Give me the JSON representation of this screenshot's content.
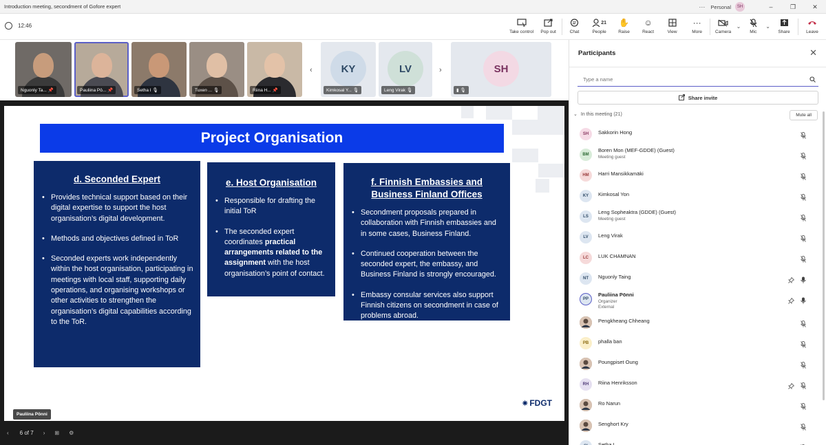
{
  "window": {
    "title": "Introduction meeting, secondment of Gofore expert",
    "profile": "Personal",
    "profile_initials": "SH"
  },
  "meeting": {
    "elapsed": "12:46",
    "people_count": "21"
  },
  "toolbar": {
    "take_control": "Take control",
    "pop_out": "Pop out",
    "chat": "Chat",
    "people": "People",
    "raise": "Raise",
    "react": "React",
    "view": "View",
    "more": "More",
    "camera": "Camera",
    "mic": "Mic",
    "share": "Share",
    "leave": "Leave"
  },
  "video_strip": [
    {
      "label": "Nguonly Ta..."
    },
    {
      "label": "Pauliina Pö..."
    },
    {
      "label": "Setha I"
    },
    {
      "label": "Tuxen ..."
    },
    {
      "label": "Riina H..."
    },
    {
      "label": "Kimkosal Y...",
      "initials": "KY"
    },
    {
      "label": "Leng Virak",
      "initials": "LV"
    },
    {
      "label": "",
      "initials": "SH"
    }
  ],
  "slide": {
    "title": "Project Organisation",
    "col_d": {
      "heading": "d. Seconded Expert",
      "b1": "Provides technical support based on their digital expertise to support the host organisation’s digital development.",
      "b2": "Methods and objectives defined in ToR",
      "b3": "Seconded experts work independently within the host organisation, participating in meetings with local staff, supporting daily operations, and organising workshops or other activities to strengthen the organisation’s digital capabilities according to the ToR."
    },
    "col_e": {
      "heading": "e. Host Organisation",
      "b1": "Responsible for drafting the initial ToR",
      "b2_pre": "The seconded expert coordinates ",
      "b2_bold": "practical arrangements related to the assignment",
      "b2_post": " with the host organisation’s point of contact."
    },
    "col_f": {
      "heading1": "f. Finnish Embassies and",
      "heading2": "Business Finland Offices",
      "b1": "Secondment proposals prepared in collaboration with Finnish embassies and in some cases, Business Finland.",
      "b2": "Continued cooperation between the seconded expert, the embassy, and Business Finland is strongly encouraged.",
      "b3": "Embassy consular services also support Finnish citizens on secondment in case of problems abroad."
    },
    "logo": "FDGT",
    "presenter": "Pauliina Pönni",
    "page": "6 of 7"
  },
  "panel": {
    "title": "Participants",
    "search_placeholder": "Type a name",
    "share_invite": "Share invite",
    "in_meeting": "In this meeting (21)",
    "mute_all": "Mute all",
    "participants": [
      {
        "initials": "SH",
        "name": "Sakkorin Hong",
        "bg": "#f6dbe6",
        "fg": "#8a3a62"
      },
      {
        "initials": "BM",
        "name": "Boren Mon (MEF-GDDE) (Guest)",
        "sub": "Meeting guest",
        "bg": "#d8ecd9",
        "fg": "#2f6b36"
      },
      {
        "initials": "HM",
        "name": "Harri Mansikkamäki",
        "bg": "#f6dada",
        "fg": "#9a3b3b"
      },
      {
        "initials": "KY",
        "name": "Kimkosal Yon",
        "bg": "#dde6f1",
        "fg": "#2f4a66"
      },
      {
        "initials": "LS",
        "name": "Leng Sopheaktra (GDDE) (Guest)",
        "sub": "Meeting guest",
        "bg": "#dde6f1",
        "fg": "#2f4a66"
      },
      {
        "initials": "LV",
        "name": "Leng Virak",
        "bg": "#dde6f1",
        "fg": "#2f4a66"
      },
      {
        "initials": "LC",
        "name": "LUK CHAMNAN",
        "bg": "#f6dada",
        "fg": "#9a3b3b"
      },
      {
        "initials": "NT",
        "name": "Nguonly Taing",
        "bg": "#dde6f1",
        "fg": "#2f4a66"
      },
      {
        "initials": "PP",
        "name": "Pauliina Pönni",
        "sub": "Organizer",
        "sub2": "External",
        "bg": "#dde6f1",
        "fg": "#2f4a66"
      },
      {
        "initials": "",
        "name": "Pengkheang Chheang",
        "photo": true
      },
      {
        "initials": "PB",
        "name": "phalla ban",
        "bg": "#fbefc9",
        "fg": "#8a6a10"
      },
      {
        "initials": "",
        "name": "Poungpiset Oung",
        "photo": true
      },
      {
        "initials": "RH",
        "name": "Riina Henriksson",
        "bg": "#e6e0f1",
        "fg": "#4f3a78"
      },
      {
        "initials": "",
        "name": "Ro Narun",
        "photo": true
      },
      {
        "initials": "",
        "name": "Senghort Kry",
        "photo": true
      },
      {
        "initials": "SI",
        "name": "Setha I",
        "bg": "#dde6f1",
        "fg": "#2f4a66"
      }
    ]
  },
  "colors": {
    "accent": "#5b5fc7",
    "slide_title_bg": "#0b3be8",
    "slide_box_bg": "#0d2b6b",
    "leave": "#c4314b"
  }
}
